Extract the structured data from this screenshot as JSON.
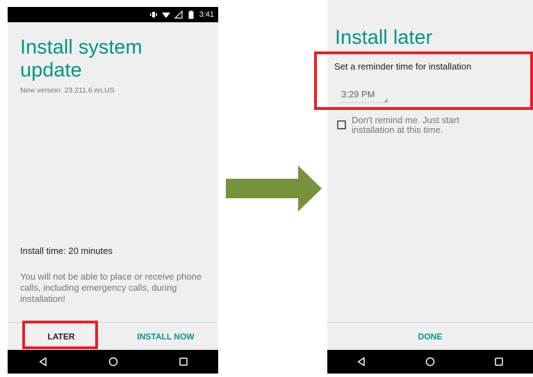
{
  "left_screen": {
    "status_bar": {
      "time": "3:41",
      "icons": [
        "vibrate-icon",
        "wifi-icon",
        "no-sim-icon",
        "battery-icon"
      ]
    },
    "title": "Install system update",
    "version": "New version: 23.211.6.en.US",
    "install_time": "Install time: 20 minutes",
    "warning": "You will not be able to place or receive phone calls, including emergency calls, during installation!",
    "buttons": {
      "later": "LATER",
      "install_now": "INSTALL NOW"
    },
    "nav": [
      "back-icon",
      "home-icon",
      "recents-icon"
    ]
  },
  "right_screen": {
    "title": "Install later",
    "reminder_label": "Set a reminder time for installation",
    "reminder_time": "3:29 PM",
    "checkbox_label": "Don't remind me. Just start installation at this time.",
    "checkbox_checked": false,
    "buttons": {
      "done": "DONE"
    },
    "nav": [
      "back-icon",
      "home-icon",
      "recents-icon"
    ]
  },
  "colors": {
    "accent": "#009688",
    "highlight": "#ec1c24",
    "arrow": "#76923c"
  }
}
